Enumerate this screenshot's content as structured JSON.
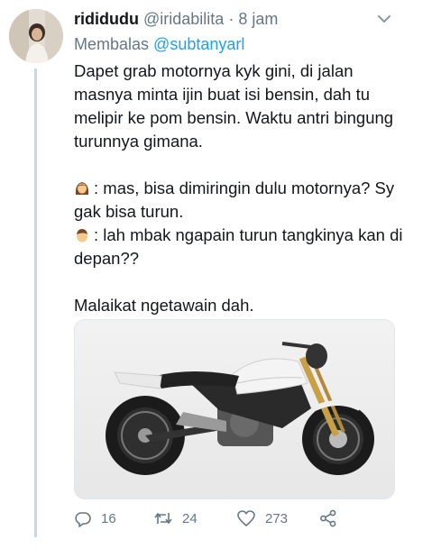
{
  "tweet": {
    "display_name": "rididudu",
    "handle": "@iridabilita",
    "separator": "·",
    "time": "8 jam",
    "reply_prefix": "Membalas",
    "reply_to": "@subtanyarl",
    "paragraph1": "Dapet grab motornya kyk gini, di jalan masnya minta ijin buat isi bensin, dah tu melipir ke pom bensin. Waktu antri bingung turunnya gimana.",
    "dialog1": ": mas, bisa dimiringin dulu motornya? Sy gak bisa turun.",
    "dialog2": ": lah mbak ngapain turun tangkinya kan di depan??",
    "closing": "Malaikat ngetawain dah."
  },
  "actions": {
    "replies": "16",
    "retweets": "24",
    "likes": "273"
  },
  "icons": {
    "woman": "woman-emoji-icon",
    "man": "man-emoji-icon",
    "reply": "reply-icon",
    "retweet": "retweet-icon",
    "like": "heart-icon",
    "share": "share-icon",
    "menu": "chevron-down-icon"
  },
  "colors": {
    "text": "#14171a",
    "muted": "#657786",
    "link": "#1da1f2",
    "thread": "#ccd6dd"
  }
}
